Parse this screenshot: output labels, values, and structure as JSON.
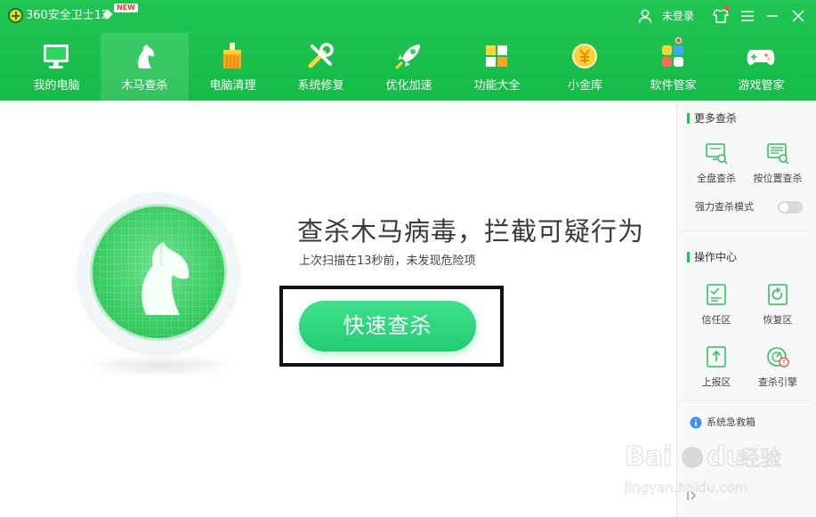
{
  "app": {
    "title": "360安全卫士12",
    "badge": "NEW"
  },
  "titlebar": {
    "login_label": "未登录"
  },
  "nav": {
    "items": [
      {
        "label": "我的电脑",
        "icon": "monitor-icon"
      },
      {
        "label": "木马查杀",
        "icon": "horse-icon",
        "active": true
      },
      {
        "label": "电脑清理",
        "icon": "broom-icon"
      },
      {
        "label": "系统修复",
        "icon": "tools-icon"
      },
      {
        "label": "优化加速",
        "icon": "rocket-icon"
      },
      {
        "label": "功能大全",
        "icon": "grid-icon"
      },
      {
        "label": "小金库",
        "icon": "coin-icon"
      },
      {
        "label": "软件管家",
        "icon": "apps-icon",
        "notification": true
      },
      {
        "label": "游戏管家",
        "icon": "gamepad-icon"
      }
    ]
  },
  "main": {
    "headline": "查杀木马病毒，拦截可疑行为",
    "subline": "上次扫描在13秒前，未发现危险项",
    "scan_button": "快速查杀"
  },
  "sidebar": {
    "more_title": "更多查杀",
    "full_scan": "全盘查杀",
    "location_scan": "按位置查杀",
    "strong_mode": "强力查杀模式",
    "strong_mode_on": false,
    "ops_title": "操作中心",
    "trust": "信任区",
    "restore": "恢复区",
    "report": "上报区",
    "engine": "查杀引擎",
    "emergency": "系统急救箱"
  },
  "watermark": {
    "brand": "Bai",
    "brand2": "du",
    "cn": "经验",
    "url": "jingyan.baidu.com"
  },
  "colors": {
    "header_green": "#1cc14d",
    "button_green": "#2ad47a",
    "accent_green": "#22c052"
  }
}
